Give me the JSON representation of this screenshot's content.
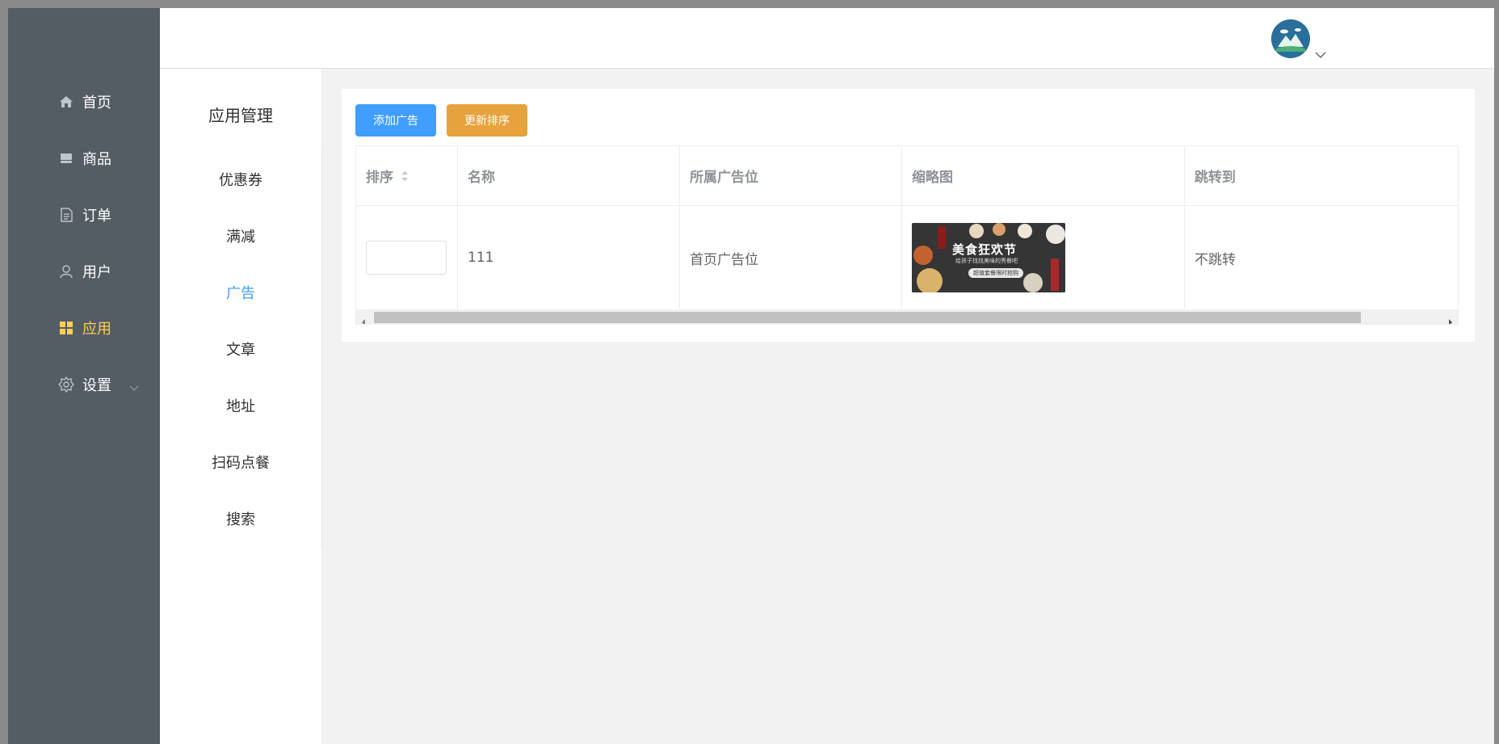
{
  "sidebar": {
    "items": [
      {
        "label": "首页",
        "icon": "home-icon"
      },
      {
        "label": "商品",
        "icon": "goods-icon"
      },
      {
        "label": "订单",
        "icon": "document-icon"
      },
      {
        "label": "用户",
        "icon": "user-icon"
      },
      {
        "label": "应用",
        "icon": "grid-icon",
        "active": true
      },
      {
        "label": "设置",
        "icon": "gear-icon"
      }
    ],
    "active_color": "#ffd04b"
  },
  "header": {
    "avatar": "avatar-mountain-icon"
  },
  "submenu": {
    "title": "应用管理",
    "items": [
      {
        "label": "优惠券"
      },
      {
        "label": "满减"
      },
      {
        "label": "广告",
        "active": true
      },
      {
        "label": "文章"
      },
      {
        "label": "地址"
      },
      {
        "label": "扫码点餐"
      },
      {
        "label": "搜索"
      }
    ]
  },
  "toolbar": {
    "add_label": "添加广告",
    "update_label": "更新排序"
  },
  "table": {
    "columns": [
      "排序",
      "名称",
      "所属广告位",
      "缩略图",
      "跳转到"
    ],
    "rows": [
      {
        "sort": "",
        "name": "111",
        "position": "首页广告位",
        "thumbnail": {
          "text_main": "美食狂欢节",
          "text_sub": "给孩子找找美味的秀餐吧",
          "text_badge": "超值套餐限时抢购"
        },
        "jump": "不跳转"
      }
    ]
  },
  "colors": {
    "sidebar_bg": "#545c64",
    "primary": "#409eff",
    "warning": "#e6a23c"
  }
}
